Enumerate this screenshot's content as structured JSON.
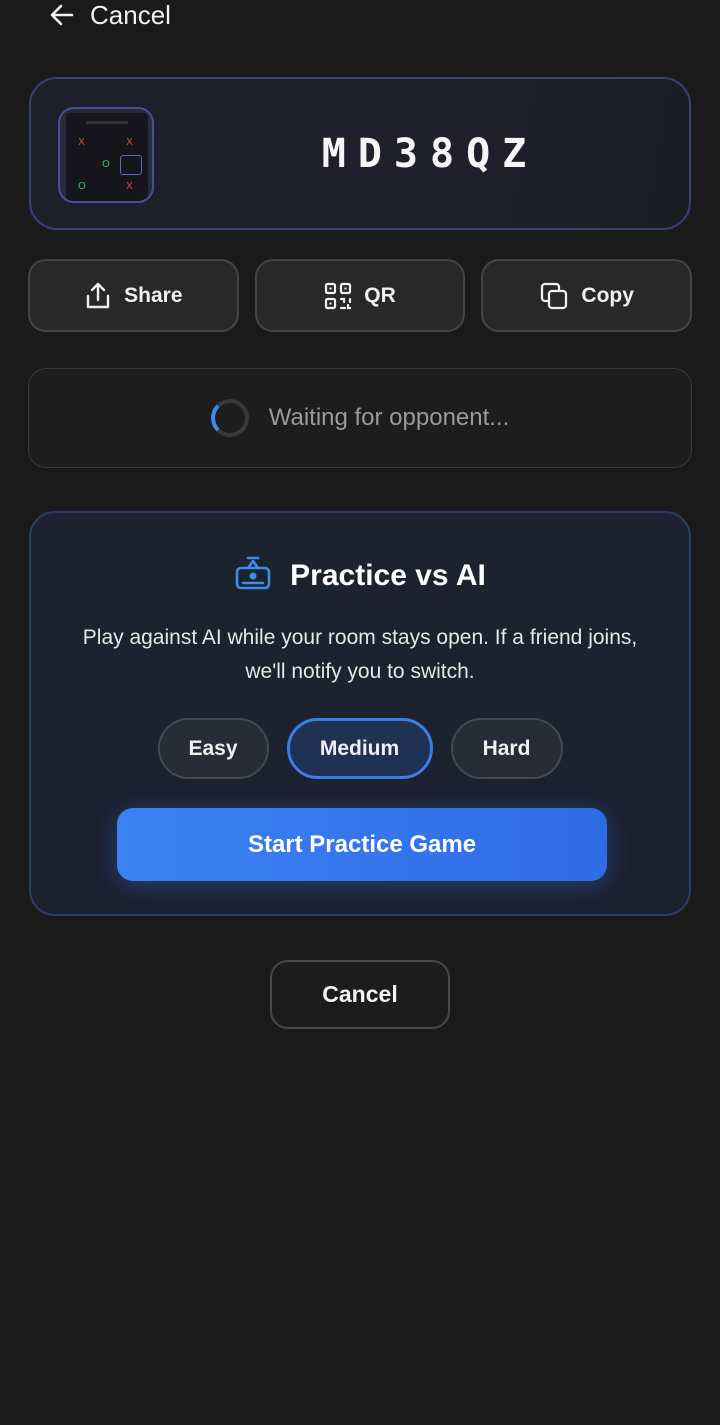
{
  "topbar": {
    "back_label": "Cancel"
  },
  "room": {
    "code": "MD38QZ",
    "thumbnail_marks": [
      "X",
      "X",
      "O",
      "O",
      "X"
    ]
  },
  "actions": {
    "share_label": "Share",
    "qr_label": "QR",
    "copy_label": "Copy"
  },
  "status": {
    "waiting_text": "Waiting for opponent..."
  },
  "practice": {
    "title": "Practice vs AI",
    "description": "Play against AI while your room stays open. If a friend joins, we'll notify you to switch.",
    "levels": [
      "Easy",
      "Medium",
      "Hard"
    ],
    "selected_level": "Medium",
    "start_label": "Start Practice Game"
  },
  "footer": {
    "cancel_label": "Cancel"
  },
  "colors": {
    "accent": "#3b82f6",
    "background": "#1a1a1a",
    "room_border": "#3b3f7a",
    "spinner": "#3d8ce8"
  },
  "icons": {
    "back": "arrow-left-icon",
    "share": "share-icon",
    "qr": "qr-code-icon",
    "copy": "copy-icon",
    "practice": "robot-icon"
  }
}
